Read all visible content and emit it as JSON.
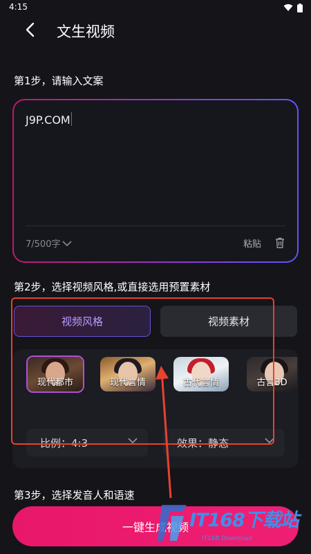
{
  "status_bar": {
    "time": "4:15"
  },
  "header": {
    "title": "文生视频"
  },
  "step1": {
    "label": "第1步，请输入文案",
    "text_value": "J9P.COM",
    "counter": "7/500字",
    "paste_label": "粘贴"
  },
  "step2": {
    "label": "第2步，选择视频风格,或直接选用预置素材",
    "tabs": [
      {
        "label": "视频风格",
        "active": true
      },
      {
        "label": "视频素材",
        "active": false
      }
    ],
    "styles": [
      {
        "label": "现代都市",
        "selected": true
      },
      {
        "label": "现代言情",
        "selected": false
      },
      {
        "label": "古代言情",
        "selected": false
      },
      {
        "label": "古言3D",
        "selected": false
      }
    ],
    "ratio": "比例：4:3",
    "effect": "效果：静态"
  },
  "step3": {
    "label": "第3步，选择发音人和语速"
  },
  "generate_button": {
    "label": "一键生成视频"
  },
  "watermark": {
    "text": "IT168下载站",
    "sub": "IT168 Download"
  },
  "colors": {
    "accent": "#e8176a",
    "tab_active_text": "#b79cff",
    "annotation": "#e8432c"
  }
}
